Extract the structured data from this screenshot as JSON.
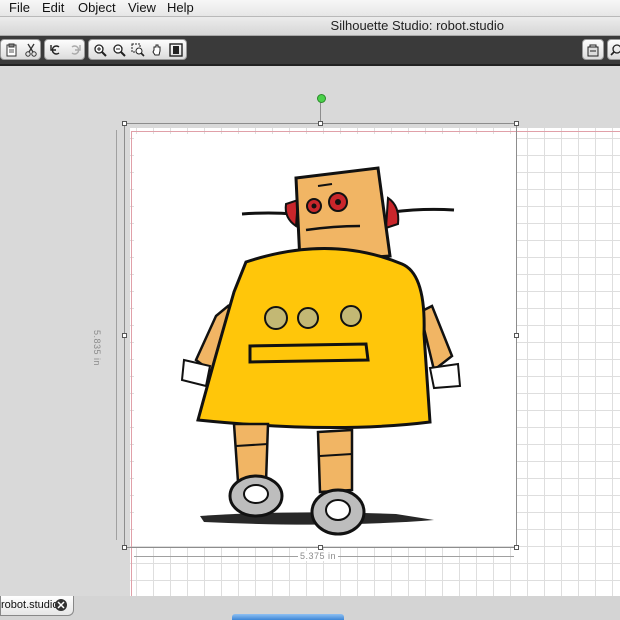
{
  "menubar": {
    "items": [
      "File",
      "Edit",
      "Object",
      "View",
      "Help"
    ]
  },
  "window": {
    "title": "Silhouette Studio: robot.studio"
  },
  "toolbar": {
    "icons": [
      "paste-icon",
      "cut-icon",
      "undo-icon",
      "redo-icon",
      "zoom-in-icon",
      "zoom-out-icon",
      "zoom-select-icon",
      "pan-icon",
      "fit-page-icon",
      "cutting-mat-icon",
      "zoom-icon"
    ]
  },
  "canvas": {
    "height_label": "5.835 in",
    "width_label": "5.375 in"
  },
  "document_tab": {
    "label": "robot.studio"
  },
  "colors": {
    "robot_body": "#ffc60a",
    "robot_head": "#f1b564",
    "robot_ears": "#c9262b",
    "toolbar_bg": "#3a3a3a",
    "page_border": "#e0a0a8"
  }
}
